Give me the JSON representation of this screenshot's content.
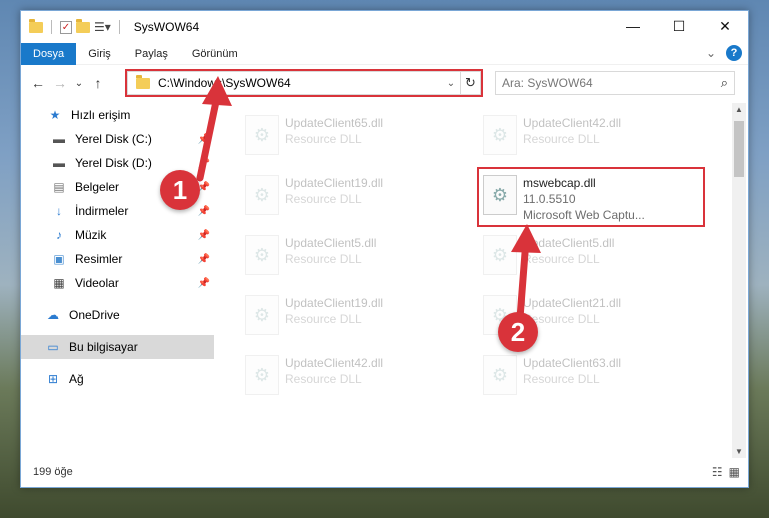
{
  "window": {
    "title": "SysWOW64"
  },
  "window_controls": {
    "minimize": "—",
    "maximize": "☐",
    "close": "✕"
  },
  "ribbon": {
    "tabs": [
      {
        "label": "Dosya",
        "active": true
      },
      {
        "label": "Giriş"
      },
      {
        "label": "Paylaş"
      },
      {
        "label": "Görünüm"
      }
    ],
    "expand": "⌄",
    "help": "?"
  },
  "nav": {
    "back": "←",
    "forward": "→",
    "recent": "⌄",
    "up": "↑",
    "address": "C:\\Windows\\SysWOW64",
    "address_dropdown": "⌄",
    "refresh": "↻",
    "search_placeholder": "Ara: SysWOW64",
    "search_icon": "⌕"
  },
  "sidebar": {
    "quick_access": "Hızlı erişim",
    "items": [
      {
        "label": "Yerel Disk (C:)",
        "icon": "drive-icon",
        "pinned": true
      },
      {
        "label": "Yerel Disk (D:)",
        "icon": "drive-icon",
        "pinned": true
      },
      {
        "label": "Belgeler",
        "icon": "documents-icon",
        "pinned": true
      },
      {
        "label": "İndirmeler",
        "icon": "downloads-icon",
        "pinned": true
      },
      {
        "label": "Müzik",
        "icon": "music-icon",
        "pinned": true
      },
      {
        "label": "Resimler",
        "icon": "pictures-icon",
        "pinned": true
      },
      {
        "label": "Videolar",
        "icon": "videos-icon",
        "pinned": true
      }
    ],
    "onedrive": "OneDrive",
    "this_pc": "Bu bilgisayar",
    "network": "Ağ"
  },
  "files": [
    {
      "name": "UpdateClient65.dll",
      "type": "Resource DLL",
      "col": 0,
      "row": 0,
      "faded": true
    },
    {
      "name": "UpdateClient42.dll",
      "type": "Resource DLL",
      "col": 1,
      "row": 0,
      "faded": true
    },
    {
      "name": "UpdateClient19.dll",
      "type": "Resource DLL",
      "col": 0,
      "row": 1,
      "faded": true
    },
    {
      "name": "mswebcap.dll",
      "version": "11.0.5510",
      "description": "Microsoft Web Captu...",
      "col": 1,
      "row": 1,
      "faded": false,
      "highlighted": true
    },
    {
      "name": "UpdateClient5.dll",
      "type": "Resource DLL",
      "col": 0,
      "row": 2,
      "faded": true
    },
    {
      "name": "UpdateClient5.dll",
      "type": "Resource DLL",
      "col": 1,
      "row": 2,
      "faded": true
    },
    {
      "name": "UpdateClient19.dll",
      "type": "Resource DLL",
      "col": 0,
      "row": 3,
      "faded": true
    },
    {
      "name": "UpdateClient21.dll",
      "type": "Resource DLL",
      "col": 1,
      "row": 3,
      "faded": true
    },
    {
      "name": "UpdateClient42.dll",
      "type": "Resource DLL",
      "col": 0,
      "row": 4,
      "faded": true
    },
    {
      "name": "UpdateClient63.dll",
      "type": "Resource DLL",
      "col": 1,
      "row": 4,
      "faded": true
    }
  ],
  "status": {
    "count": "199 öğe"
  },
  "annotations": {
    "step1": "1",
    "step2": "2"
  },
  "colors": {
    "accent": "#1979ca",
    "highlight": "#d9333a"
  }
}
